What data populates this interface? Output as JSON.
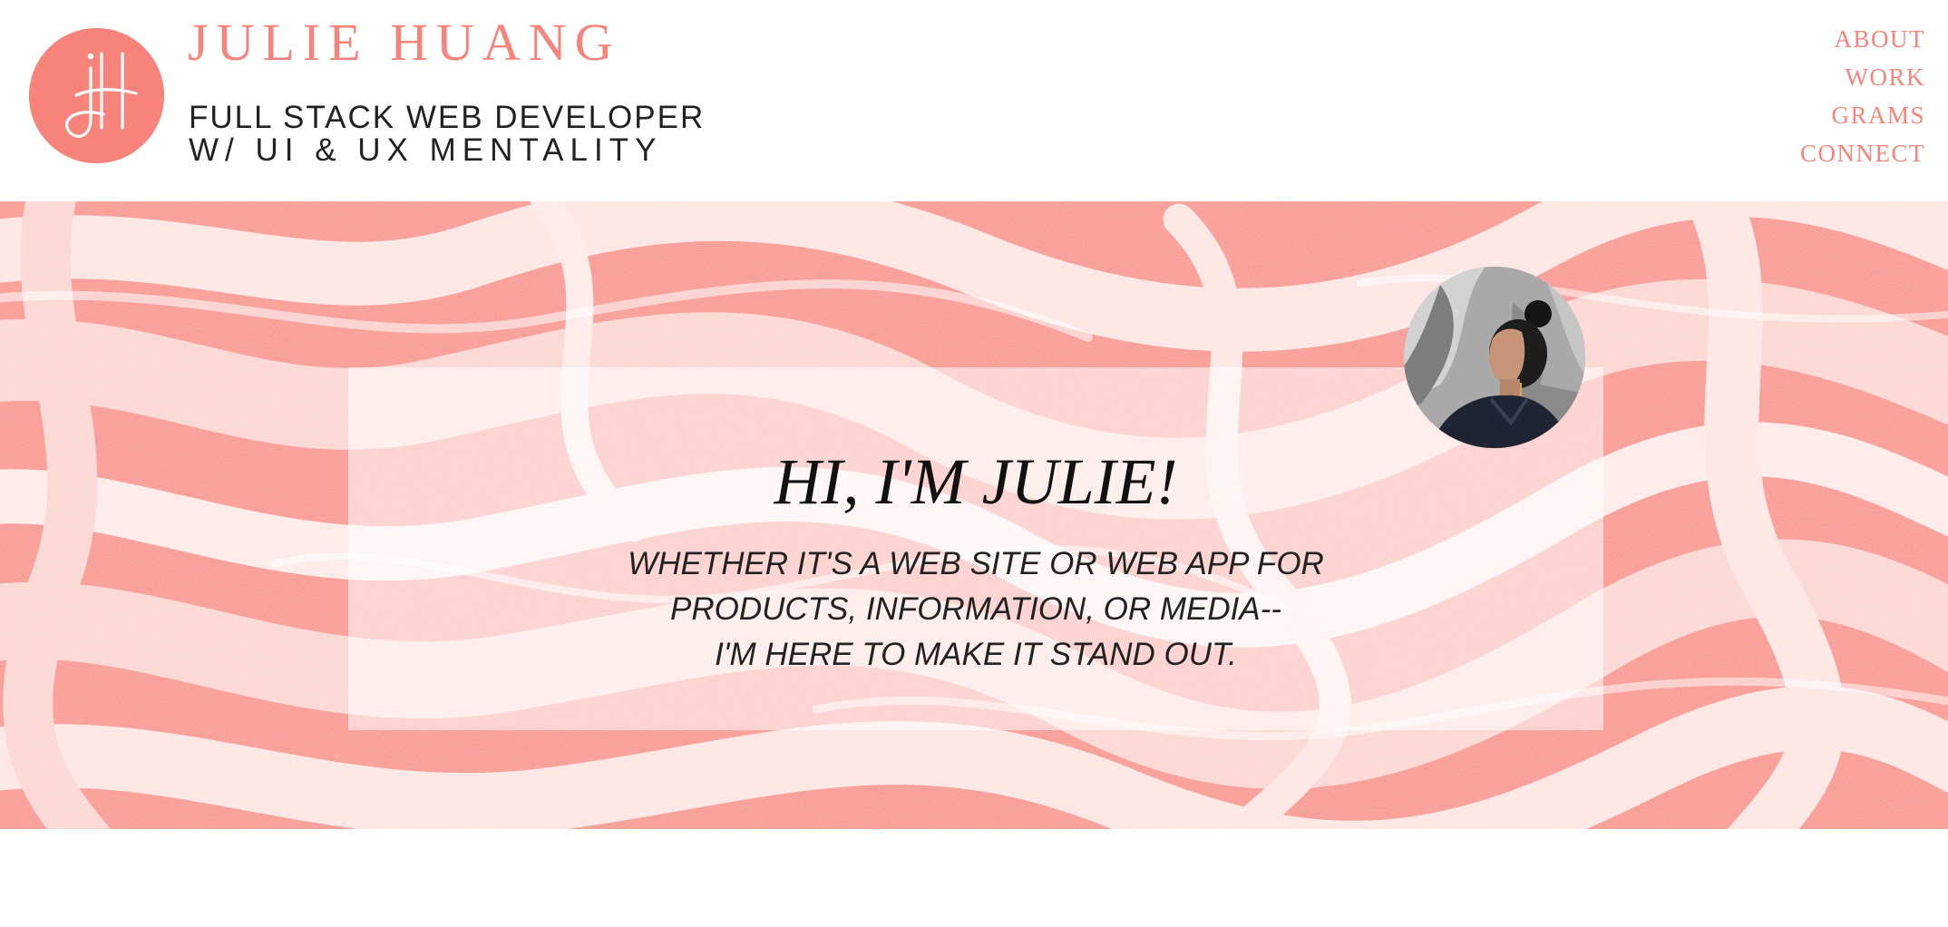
{
  "brand": {
    "name": "JULIE HUANG",
    "tagline_line1": "FULL STACK WEB DEVELOPER",
    "tagline_line2": "W/ UI & UX MENTALITY",
    "logo_icon": "jh-monogram-icon"
  },
  "nav": {
    "items": [
      {
        "label": "ABOUT"
      },
      {
        "label": "WORK"
      },
      {
        "label": "GRAMS"
      },
      {
        "label": "CONNECT"
      }
    ]
  },
  "hero": {
    "greeting": "HI, I'M JULIE!",
    "pitch_line1": "WHETHER IT'S A WEB SITE OR WEB APP FOR",
    "pitch_line2": "PRODUCTS, INFORMATION, OR MEDIA--",
    "pitch_line3": "I'M HERE TO MAKE IT STAND OUT.",
    "background": "pink-marble-texture",
    "avatar": "profile-photo"
  },
  "colors": {
    "accent": "#f7837a",
    "marble_light": "#fbd2cd",
    "marble_dark": "#f98e87",
    "text": "#111111"
  }
}
